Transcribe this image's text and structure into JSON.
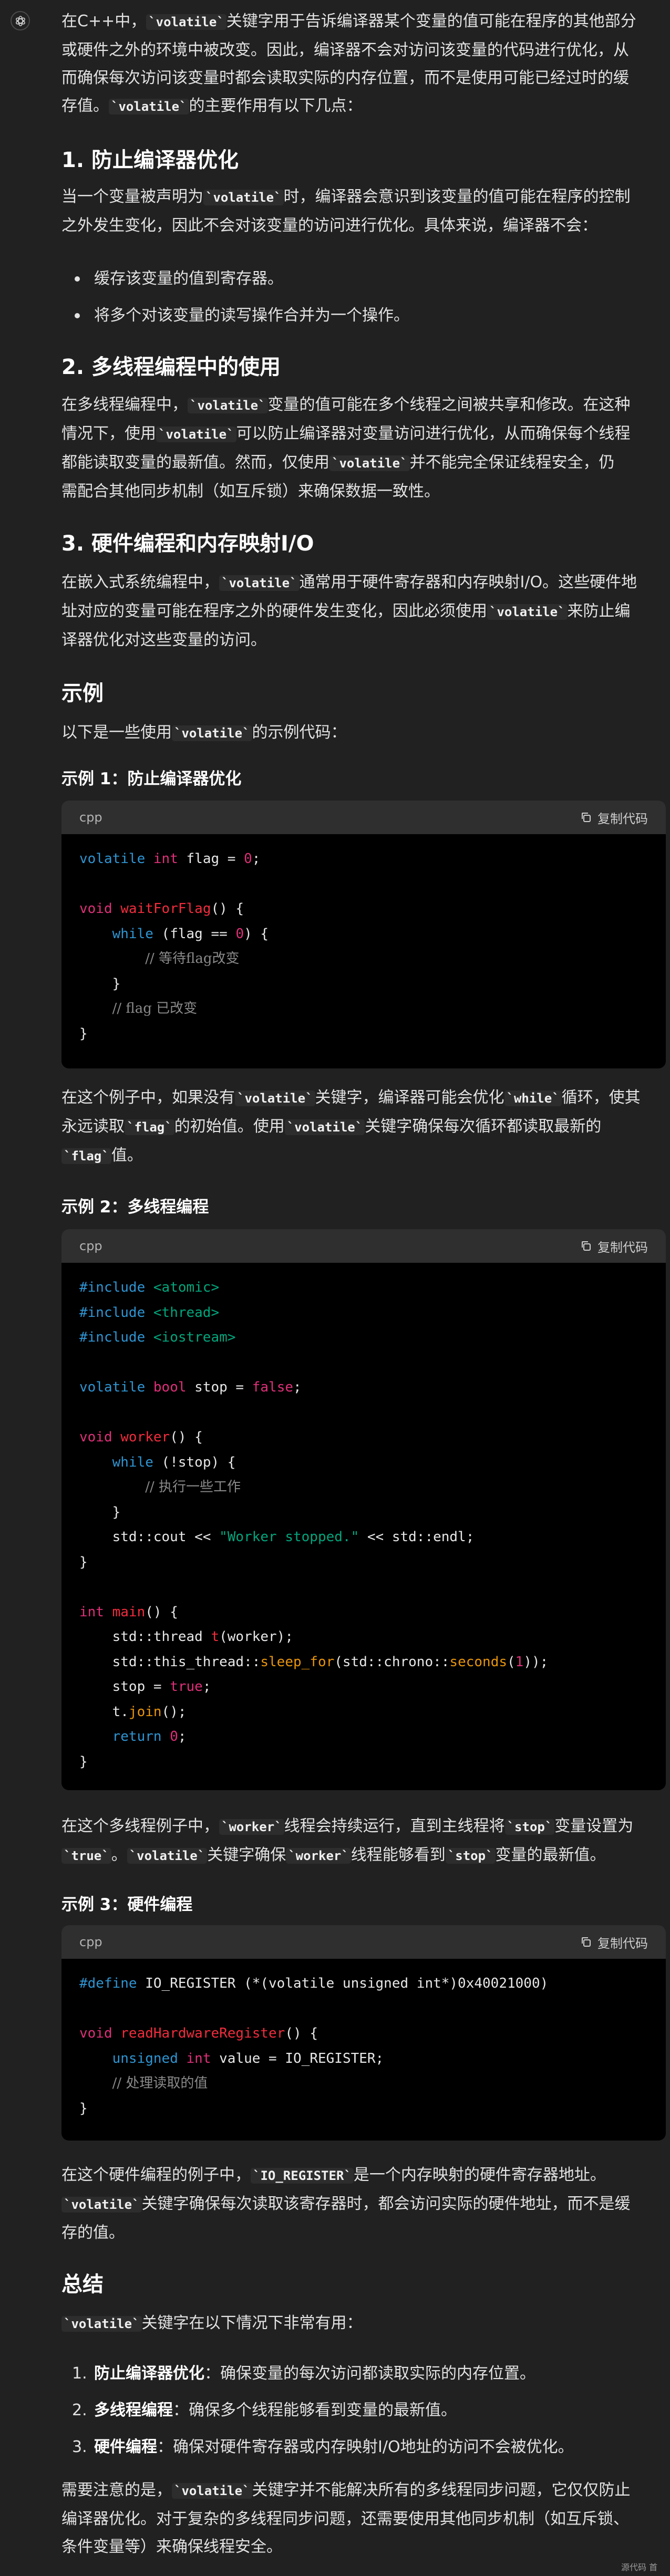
{
  "assistant_avatar": {
    "icon": "openai-logo-icon"
  },
  "intro": [
    "在C++中，`volatile`关键字用于告诉编译器某个变量的值可能在程序的其他部分",
    "或硬件之外的环境中被改变。因此，编译器不会对访问该变量的代码进行优化，从",
    "而确保每次访问该变量时都会读取实际的内存位置，而不是使用可能已经过时的缓",
    "存值。`volatile`的主要作用有以下几点："
  ],
  "sections": [
    {
      "title": "1. 防止编译器优化"
    },
    {
      "title": "2. 多线程编程中的使用"
    },
    {
      "title": "3. 硬件编程和内存映射I/O"
    },
    {
      "title": "示例"
    },
    {
      "title": "总结"
    }
  ],
  "s1_text": [
    "当一个变量被声明为`volatile`时，编译器会意识到该变量的值可能在程序的控制",
    "之外发生变化，因此不会对该变量的访问进行优化。具体来说，编译器不会："
  ],
  "s1_bullets": [
    "缓存该变量的值到寄存器。",
    "将多个对该变量的读写操作合并为一个操作。"
  ],
  "s2_text": [
    "在多线程编程中，`volatile`变量的值可能在多个线程之间被共享和修改。在这种",
    "情况下，使用`volatile`可以防止编译器对变量访问进行优化，从而确保每个线程",
    "都能读取变量的最新值。然而，仅使用`volatile`并不能完全保证线程安全，仍",
    "需配合其他同步机制（如互斥锁）来确保数据一致性。"
  ],
  "s3_text": [
    "在嵌入式系统编程中，`volatile`通常用于硬件寄存器和内存映射I/O。这些硬件地",
    "址对应的变量可能在程序之外的硬件发生变化，因此必须使用`volatile`来防止编",
    "译器优化对这些变量的访问。"
  ],
  "examples_intro": "以下是一些使用`volatile`的示例代码：",
  "examples": [
    {
      "title": "示例 1：防止编译器优化",
      "lang": "cpp",
      "copy_label": "复制代码"
    },
    {
      "title": "示例 2：多线程编程",
      "lang": "cpp",
      "copy_label": "复制代码"
    },
    {
      "title": "示例 3：硬件编程",
      "lang": "cpp",
      "copy_label": "复制代码"
    }
  ],
  "code": {
    "ex1": [
      "volatile int flag = 0;",
      "",
      "void waitForFlag() {",
      "    while (flag == 0) {",
      "        // 等待flag改变",
      "    }",
      "    // flag 已改变",
      "}"
    ],
    "ex2": [
      "#include <atomic>",
      "#include <thread>",
      "#include <iostream>",
      "",
      "volatile bool stop = false;",
      "",
      "void worker() {",
      "    while (!stop) {",
      "        // 执行一些工作",
      "    }",
      "    std::cout << \"Worker stopped.\" << std::endl;",
      "}",
      "",
      "int main() {",
      "    std::thread t(worker);",
      "    std::this_thread::sleep_for(std::chrono::seconds(1));",
      "    stop = true;",
      "    t.join();",
      "    return 0;",
      "}"
    ],
    "ex3": [
      "#define IO_REGISTER (*(volatile unsigned int*)0x40021000)",
      "",
      "void readHardwareRegister() {",
      "    unsigned int value = IO_REGISTER;",
      "    // 处理读取的值",
      "}"
    ]
  },
  "ex1_after": [
    "在这个例子中，如果没有`volatile`关键字，编译器可能会优化`while`循环，使其",
    "永远读取`flag`的初始值。使用`volatile`关键字确保每次循环都读取最新的",
    "`flag`值。"
  ],
  "ex2_after": [
    "在这个多线程例子中，`worker`线程会持续运行，直到主线程将`stop`变量设置为",
    "`true`。`volatile`关键字确保`worker`线程能够看到`stop`变量的最新值。"
  ],
  "ex3_after": [
    "在这个硬件编程的例子中，`IO_REGISTER`是一个内存映射的硬件寄存器地址。",
    "`volatile`关键字确保每次读取该寄存器时，都会访问实际的硬件地址，而不是缓",
    "存的值。"
  ],
  "summary_intro": "`volatile`关键字在以下情况下非常有用：",
  "summary_items": [
    {
      "num": "1.",
      "label": "防止编译器优化",
      "text": "：确保变量的每次访问都读取实际的内存位置。"
    },
    {
      "num": "2.",
      "label": "多线程编程",
      "text": "：确保多个线程能够看到变量的最新值。"
    },
    {
      "num": "3.",
      "label": "硬件编程",
      "text": "：确保对硬件寄存器或内存映射I/O地址的访问不会被优化。"
    }
  ],
  "closing": [
    "需要注意的是，`volatile`关键字并不能解决所有的多线程同步问题，它仅仅防止",
    "编译器优化。对于复杂的多线程同步问题，还需要使用其他同步机制（如互斥锁、",
    "条件变量等）来确保线程安全。"
  ],
  "footer": "源代码  首"
}
